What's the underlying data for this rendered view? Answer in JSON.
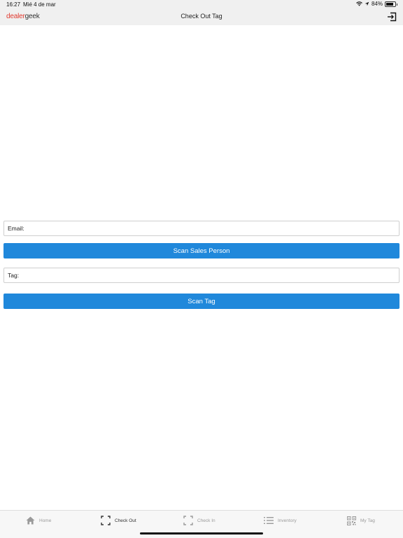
{
  "status_bar": {
    "time": "16:27",
    "date": "Mié 4 de mar",
    "battery": "84%",
    "battery_level": 0.84
  },
  "nav": {
    "logo_part1": "dealer",
    "logo_part2": "geek",
    "title": "Check Out Tag"
  },
  "form": {
    "email_label": "Email:",
    "email_value": "",
    "scan_sales_person_label": "Scan Sales Person",
    "tag_label": "Tag:",
    "tag_value": "",
    "scan_tag_label": "Scan Tag"
  },
  "tabs": [
    {
      "label": "Home"
    },
    {
      "label": "Check Out"
    },
    {
      "label": "Check In"
    },
    {
      "label": "Inventory"
    },
    {
      "label": "My Tag"
    }
  ],
  "colors": {
    "accent": "#2088db",
    "logo_red": "#e03a2f"
  }
}
